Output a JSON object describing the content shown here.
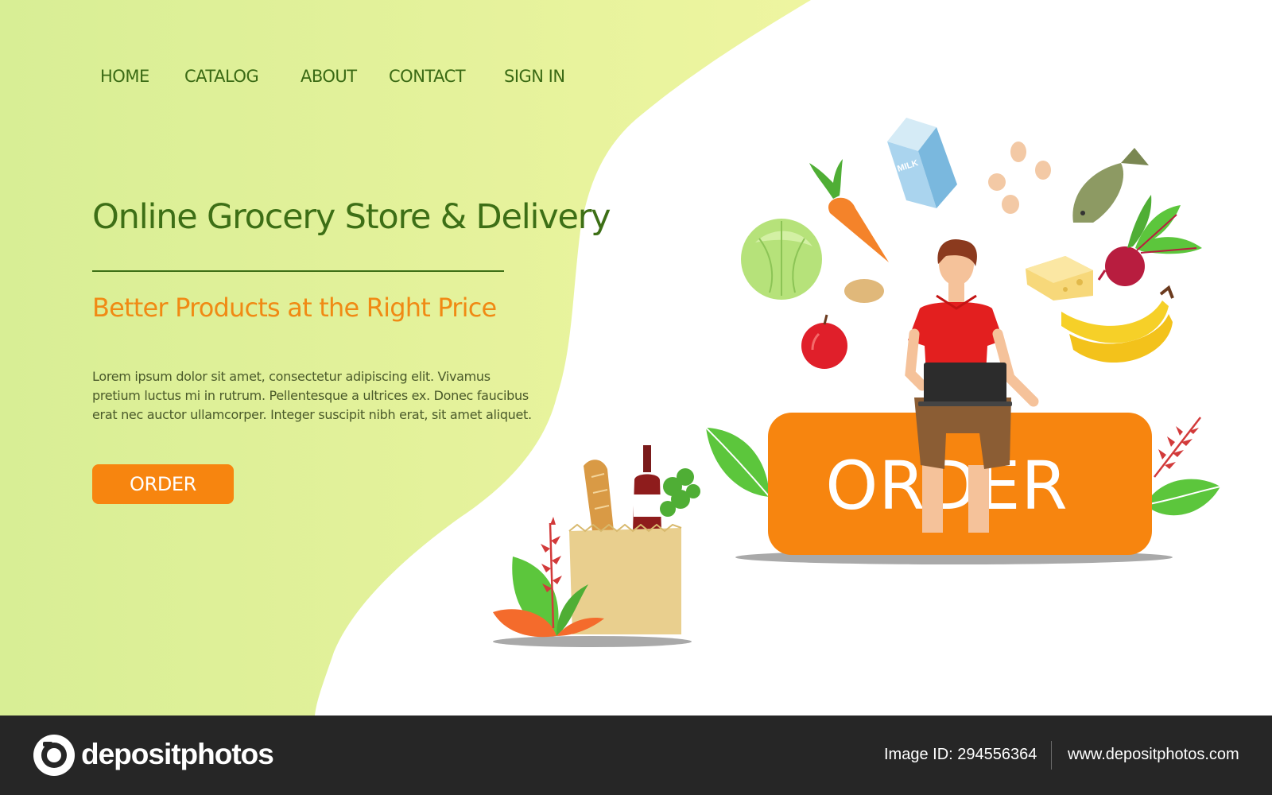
{
  "nav": {
    "items": [
      "HOME",
      "CATALOG",
      "ABOUT",
      "CONTACT",
      "SIGN IN"
    ]
  },
  "hero": {
    "title": "Online Grocery Store & Delivery",
    "subtitle": "Better Products at the Right Price",
    "body": "Lorem ipsum dolor sit amet, consectetur adipiscing elit. Vivamus pretium luctus mi in rutrum. Pellentesque a ultrices ex. Donec faucibus erat nec auctor ullamcorper. Integer suscipit nibh erat, sit amet aliquet.",
    "order_button": "ORDER"
  },
  "illustration": {
    "big_button_label": "ORDER",
    "milk_label": "MILK"
  },
  "footer": {
    "logo_text": "depositphotos",
    "image_id": "Image ID: 294556364",
    "site_url": "www.depositphotos.com"
  },
  "colors": {
    "nav_text": "#3a6a14",
    "title": "#3d6f16",
    "accent_orange": "#f7850f",
    "left_panel": "#e4f2a0",
    "footer_bg": "#262626"
  },
  "icons": [
    "camera-logo-icon",
    "milk-carton-icon",
    "carrot-icon",
    "cabbage-icon",
    "apple-icon",
    "potato-icon",
    "eggs-icon",
    "fish-icon",
    "beet-icon",
    "cheese-icon",
    "banana-icon",
    "grocery-bag-icon",
    "baguette-icon",
    "wine-bottle-icon",
    "leaf-icon"
  ]
}
